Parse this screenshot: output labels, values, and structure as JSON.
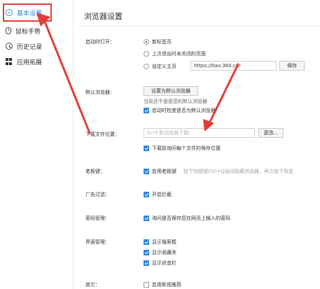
{
  "sidebar": {
    "items": [
      {
        "label": "基本设置",
        "icon": "settings-circle-icon",
        "active": true
      },
      {
        "label": "鼠标手势",
        "icon": "mouse-icon",
        "active": false
      },
      {
        "label": "历史记录",
        "icon": "clock-icon",
        "active": false
      },
      {
        "label": "应用拓展",
        "icon": "apps-grid-icon",
        "active": false
      }
    ]
  },
  "page": {
    "title": "浏览器设置"
  },
  "startup": {
    "label": "启动时打开：",
    "options": [
      "新标签页",
      "上次退出时未关闭的页面",
      "自定义主页"
    ],
    "homepage_value": "https://hao.360.cn/",
    "save_button": "保存"
  },
  "default_browser": {
    "label": "默认浏览器：",
    "set_button": "设置为默认浏览器",
    "status_text": "当前还不是是您的默认浏览器",
    "check_label": "启动时检查是否为默认浏览器"
  },
  "download": {
    "label": "下载文件位置：",
    "path_value": "D:\\千影浏览器下载\\",
    "change_button": "更改...",
    "ask_label": "下载前询问每个文件的保存位置"
  },
  "boss_key": {
    "label": "老板键：",
    "check_label": "启用老板键",
    "hint": "按下快捷键Ctrl+Q自动隐藏浏览器，再次按下恢复"
  },
  "ad_filter": {
    "label": "广告过滤：",
    "check_label": "开启拦截"
  },
  "password": {
    "label": "密码管理：",
    "check_label": "询问是否保存您在网页上输入的密码"
  },
  "ui": {
    "label": "界面管理：",
    "checks": [
      "显示搜索框",
      "显示收藏夹",
      "显示状态栏"
    ]
  },
  "other": {
    "label": "其它：",
    "check_label": "启用影视推荐"
  },
  "colors": {
    "accent": "#2e86de",
    "annotation": "#e03c3c"
  }
}
